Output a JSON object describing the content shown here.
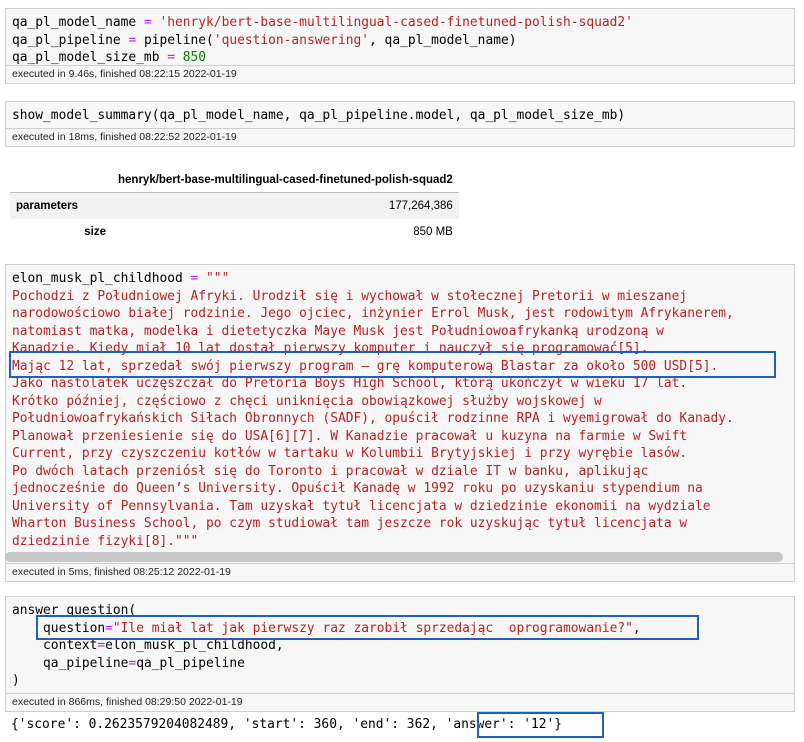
{
  "cell1": {
    "lines": [
      {
        "var": "qa_pl_model_name",
        "op": " = ",
        "val": "'henryk/bert-base-multilingual-cased-finetuned-polish-squad2'",
        "type": "str"
      },
      {
        "var": "qa_pl_pipeline",
        "op": " = ",
        "mid": "pipeline(",
        "val": "'question-answering'",
        "tail": ", qa_pl_model_name)",
        "type": "str"
      },
      {
        "var": "qa_pl_model_size_mb",
        "op": " = ",
        "val": "850",
        "type": "num"
      }
    ],
    "exec": "executed in 9.46s, finished 08:22:15 2022-01-19"
  },
  "cell2": {
    "code": "show_model_summary(qa_pl_model_name, qa_pl_pipeline.model, qa_pl_model_size_mb)",
    "exec": "executed in 18ms, finished 08:22:52 2022-01-19"
  },
  "summary_table": {
    "header": "henryk/bert-base-multilingual-cased-finetuned-polish-squad2",
    "rows": [
      {
        "label": "parameters",
        "value": "177,264,386"
      },
      {
        "label": "size",
        "value": "850 MB"
      }
    ]
  },
  "cell3": {
    "head_var": "elon_musk_pl_childhood",
    "head_op": " = ",
    "head_str": "\"\"\"",
    "text_lines": [
      "Pochodzi z Południowej Afryki. Urodził się i wychował w stołecznej Pretorii w mieszanej",
      "narodowościowo białej rodzinie. Jego ojciec, inżynier Errol Musk, jest rodowitym Afrykanerem,",
      "natomiast matka, modelka i dietetyczka Maye Musk jest Południowoafrykanką urodzoną w",
      "Kanadzie. Kiedy miał 10 lat dostał pierwszy komputer i nauczył się programować[5].",
      "Mając 12 lat, sprzedał swój pierwszy program – grę komputerową Blastar za około 500 USD[5].",
      "Jako nastolatek uczęszczał do Pretoria Boys High School, którą ukończył w wieku 17 lat.",
      "Krótko później, częściowo z chęci uniknięcia obowiązkowej służby wojskowej w",
      "Południowoafrykańskich Siłach Obronnych (SADF), opuścił rodzinne RPA i wyemigrował do Kanady.",
      "Planował przeniesienie się do USA[6][7]. W Kanadzie pracował u kuzyna na farmie w Swift",
      "Current, przy czyszczeniu kotłów w tartaku w Kolumbii Brytyjskiej i przy wyrębie lasów.",
      "Po dwóch latach przeniósł się do Toronto i pracował w dziale IT w banku, aplikując",
      "jednocześnie do Queen’s University. Opuścił Kanadę w 1992 roku po uzyskaniu stypendium na",
      "University of Pennsylvania. Tam uzyskał tytuł licencjata w dziedzinie ekonomii na wydziale",
      "Wharton Business School, po czym studiował tam jeszcze rok uzyskując tytuł licencjata w",
      "dziedzinie fizyki[8].\"\"\""
    ],
    "exec": "executed in 5ms, finished 08:25:12 2022-01-19"
  },
  "cell4": {
    "l1": "answer_question(",
    "l2_kw": "question",
    "l2_op": "=",
    "l2_str": "\"Ile miał lat jak pierwszy raz zarobił sprzedając  oprogramowanie?\"",
    "l2_tail": ",",
    "l3_kw": "context",
    "l3_op": "=",
    "l3_val": "elon_musk_pl_childhood,",
    "l4_kw": "qa_pipeline",
    "l4_op": "=",
    "l4_val": "qa_pl_pipeline",
    "l5": ")",
    "exec": "executed in 866ms, finished 08:29:50 2022-01-19"
  },
  "output": {
    "text_a": "{'score': 0.2623579204082489, 'start': 360, 'end': 362, ",
    "text_b": "'answer': '12'",
    "text_c": "}"
  },
  "colors": {
    "highlight": "#1f5fbf",
    "string": "#ba2121",
    "number": "#008000",
    "keyword": "#aa22ff"
  }
}
